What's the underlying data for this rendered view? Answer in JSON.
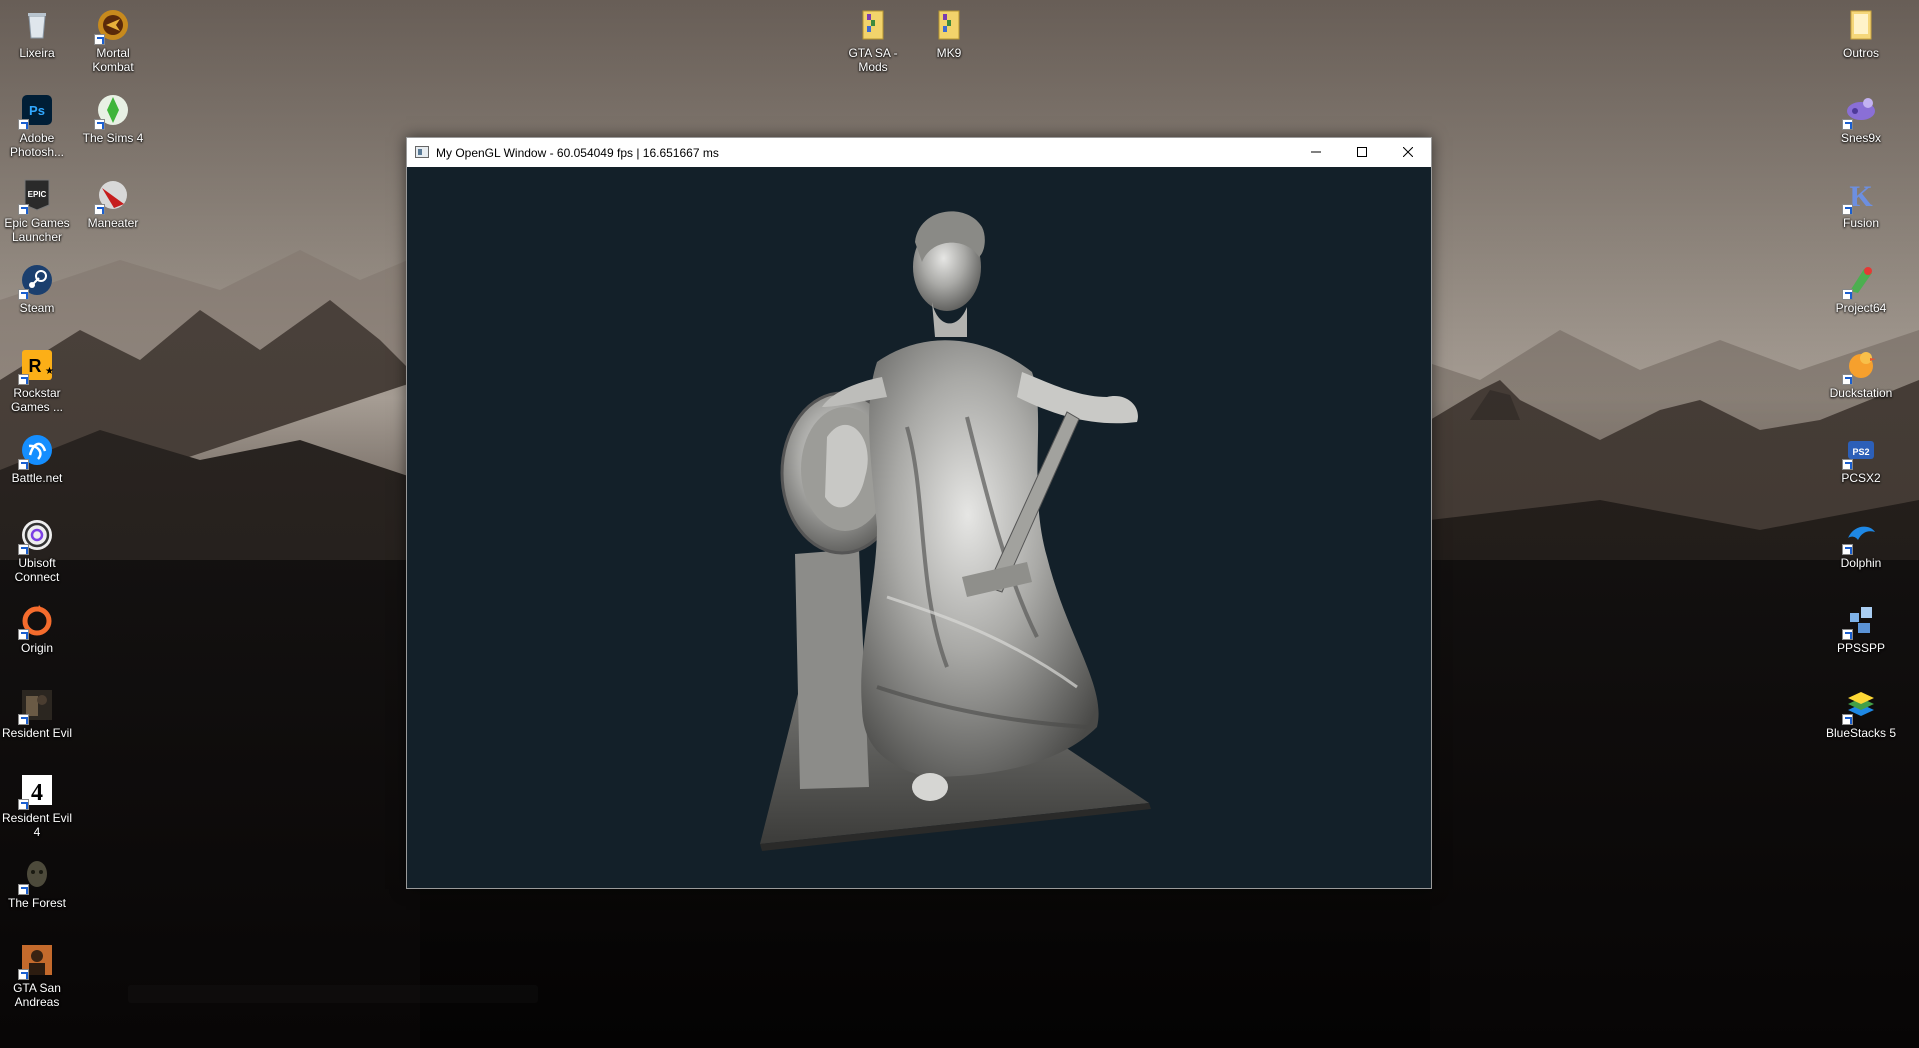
{
  "desktop": {
    "left_column_1": [
      {
        "label": "Lixeira",
        "icon": "recycle-bin-icon"
      },
      {
        "label": "Adobe Photosh...",
        "icon": "photoshop-icon"
      },
      {
        "label": "Epic Games Launcher",
        "icon": "epic-games-icon"
      },
      {
        "label": "Steam",
        "icon": "steam-icon"
      },
      {
        "label": "Rockstar Games ...",
        "icon": "rockstar-icon"
      },
      {
        "label": "Battle.net",
        "icon": "battlenet-icon"
      },
      {
        "label": "Ubisoft Connect",
        "icon": "ubisoft-icon"
      },
      {
        "label": "Origin",
        "icon": "origin-icon"
      },
      {
        "label": "Resident Evil",
        "icon": "resident-evil-icon"
      },
      {
        "label": "Resident Evil 4",
        "icon": "resident-evil-4-icon"
      },
      {
        "label": "The Forest",
        "icon": "the-forest-icon"
      },
      {
        "label": "GTA San Andreas",
        "icon": "gta-sa-icon"
      }
    ],
    "left_column_2": [
      {
        "label": "Mortal Kombat",
        "icon": "mortal-kombat-icon"
      },
      {
        "label": "The Sims 4",
        "icon": "sims-icon"
      },
      {
        "label": "Maneater",
        "icon": "maneater-icon"
      }
    ],
    "top_center": [
      {
        "label": "GTA SA - Mods",
        "icon": "folder-archive-icon"
      },
      {
        "label": "MK9",
        "icon": "folder-archive-icon"
      }
    ],
    "right_column": [
      {
        "label": "Outros",
        "icon": "folder-icon"
      },
      {
        "label": "Snes9x",
        "icon": "snes9x-icon"
      },
      {
        "label": "Fusion",
        "icon": "fusion-icon"
      },
      {
        "label": "Project64",
        "icon": "project64-icon"
      },
      {
        "label": "Duckstation",
        "icon": "duckstation-icon"
      },
      {
        "label": "PCSX2",
        "icon": "pcsx2-icon"
      },
      {
        "label": "Dolphin",
        "icon": "dolphin-icon"
      },
      {
        "label": "PPSSPP",
        "icon": "ppsspp-icon"
      },
      {
        "label": "BlueStacks 5",
        "icon": "bluestacks-icon"
      }
    ]
  },
  "window": {
    "title": "My OpenGL Window - 60.054049 fps | 16.651667 ms",
    "viewport_background": "#132029",
    "content": "statue-model"
  },
  "colors": {
    "titlebar": "#ffffff",
    "viewport": "#132029"
  }
}
